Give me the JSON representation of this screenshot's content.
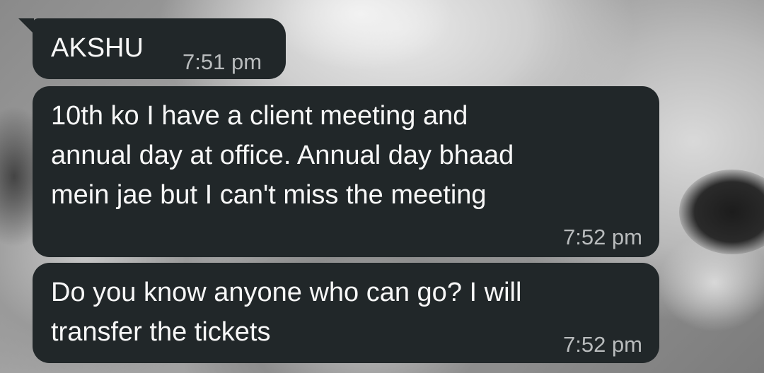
{
  "chat": {
    "messages": [
      {
        "text": "AKSHU",
        "time": "7:51 pm"
      },
      {
        "text": "10th ko I have a client meeting and\nannual day at office. Annual day bhaad\nmein jae but I can't miss the meeting",
        "time": "7:52 pm"
      },
      {
        "text": "Do you know anyone who can go? I will\ntransfer the tickets",
        "time": "7:52 pm"
      }
    ]
  },
  "colors": {
    "bubble_background": "#212729",
    "message_text": "#f7f7f7",
    "timestamp_text": "#b9bcbd"
  }
}
